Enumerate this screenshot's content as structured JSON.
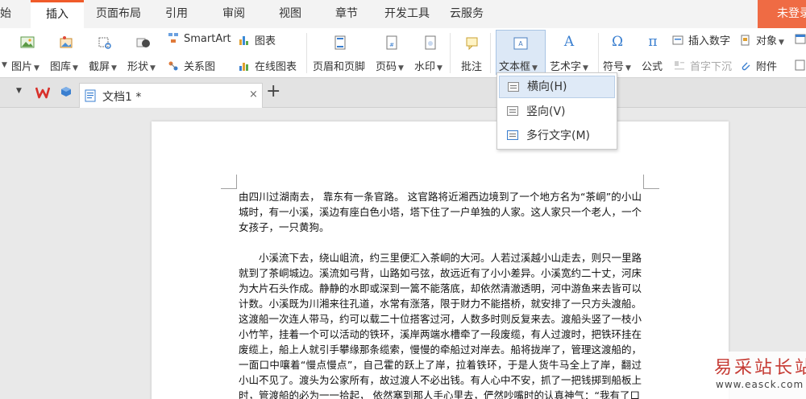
{
  "menu": {
    "tabs": [
      "始",
      "插入",
      "页面布局",
      "引用",
      "审阅",
      "视图",
      "章节",
      "开发工具",
      "云服务"
    ],
    "active_tab": "插入",
    "login": "未登录"
  },
  "ribbon": {
    "picture": "图片",
    "gallery": "图库",
    "screenshot": "截屏",
    "shapes": "形状",
    "smartart": "SmartArt",
    "chart": "图表",
    "relation": "关系图",
    "online_chart": "在线图表",
    "header_footer": "页眉和页脚",
    "page_number": "页码",
    "watermark": "水印",
    "comment": "批注",
    "textbox": "文本框",
    "wordart": "艺术字",
    "symbol": "符号",
    "formula": "公式",
    "insert_number": "插入数字",
    "object": "对象",
    "drop_cap": "首字下沉",
    "attachment": "附件"
  },
  "tabbar": {
    "doc_title": "文档1 *",
    "close": "×",
    "new_tab": "+"
  },
  "dropdown": {
    "items": [
      "横向(H)",
      "竖向(V)",
      "多行文字(M)"
    ]
  },
  "document": {
    "paragraphs": [
      "由四川过湖南去， 靠东有一条官路。 这官路将近湘西边境到了一个地方名为“茶峒”的小山城时，有一小溪，溪边有座白色小塔，塔下住了一户单独的人家。这人家只一个老人，一个女孩子，一只黄狗。",
      "小溪流下去，绕山岨流，约三里便汇入茶峒的大河。人若过溪越小山走去，则只一里路就到了茶峒城边。溪流如弓背，山路如弓弦，故远近有了小小差异。小溪宽约二十丈，河床为大片石头作成。静静的水即或深到一篙不能落底，却依然清澈透明，河中游鱼来去皆可以计数。小溪既为川湘来往孔道，水常有涨落，限于财力不能搭桥，就安排了一只方头渡船。这渡船一次连人带马，约可以载二十位搭客过河，人数多时则反复来去。渡船头竖了一枝小小竹竿，挂着一个可以活动的铁环，溪岸两端水槽牵了一段废缆，有人过渡时，把铁环挂在废缆上，船上人就引手攀缘那条缆索，慢慢的牵船过对岸去。船将拢岸了，管理这渡船的，一面口中嚷着“慢点慢点”，自己霍的跃上了岸，拉着铁环，于是人货牛马全上了岸，翻过小山不见了。渡头为公家所有，故过渡人不必出钱。有人心中不安，抓了一把钱掷到船板上时，管渡船的必为一一拾起， 依然塞到那人手心里去，俨然吵嘴时的认真神气：“我有了口"
    ]
  },
  "watermark": {
    "site": "易采站长站",
    "url": "www.easck.com"
  },
  "colors": {
    "accent": "#f05b2a",
    "login_bg": "#ef6b44",
    "dropdown_hover": "#dfeaf7"
  }
}
